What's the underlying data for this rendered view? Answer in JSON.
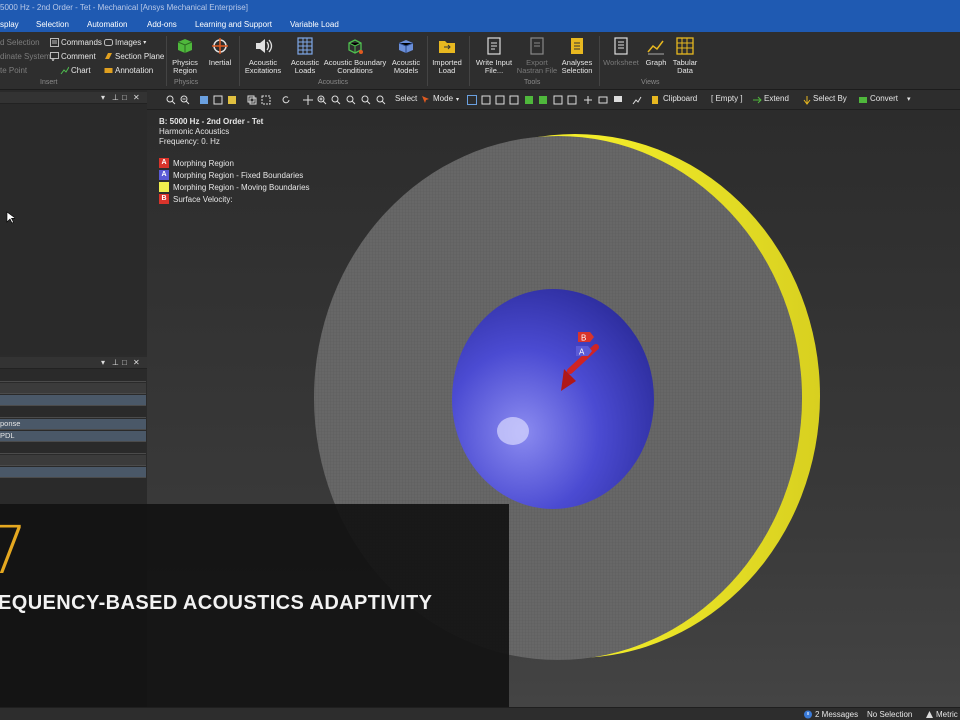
{
  "window": {
    "title": "5000 Hz - 2nd Order - Tet - Mechanical [Ansys Mechanical Enterprise]"
  },
  "menu": {
    "items": [
      "splay",
      "Selection",
      "Automation",
      "Add-ons",
      "Learning and Support",
      "Variable Load"
    ]
  },
  "ribbon": {
    "insert_small": {
      "named_selection": "d Selection",
      "coordinate_system": "dinate System",
      "remote_point": "te Point",
      "commands": "Commands",
      "comment": "Comment",
      "chart": "Chart",
      "images": "Images",
      "section_plane": "Section Plane",
      "annotation": "Annotation"
    },
    "groups": {
      "insert": "Insert",
      "physics": "Physics",
      "acoustics": "Acoustics",
      "tools": "Tools",
      "views": "Views"
    },
    "buttons": {
      "physics_region": "Physics\nRegion",
      "inertial": "Inertial",
      "acoustic_excitations": "Acoustic\nExcitations",
      "acoustic_loads": "Acoustic\nLoads",
      "acoustic_boundary_conditions": "Acoustic Boundary\nConditions",
      "acoustic_models": "Acoustic\nModels",
      "imported_load": "Imported\nLoad",
      "write_input_file": "Write Input\nFile...",
      "export_nastran_file": "Export\nNastran File",
      "analyses_selection": "Analyses\nSelection",
      "worksheet": "Worksheet",
      "graph": "Graph",
      "tabular_data": "Tabular\nData"
    }
  },
  "graphics_toolbar": {
    "select": "Select",
    "mode": "Mode",
    "clipboard": "Clipboard",
    "empty": "[ Empty ]",
    "extend": "Extend",
    "select_by": "Select By",
    "convert": "Convert"
  },
  "left_panel": {
    "rows": [
      "ponse",
      "PDL"
    ]
  },
  "viewport": {
    "analysis_title": "B: 5000 Hz - 2nd Order - Tet",
    "analysis_type": "Harmonic Acoustics",
    "frequency": "Frequency: 0. Hz",
    "legend": [
      {
        "tag": "A",
        "label": "Morphing Region",
        "color": "#d9342b"
      },
      {
        "tag": "A",
        "label": "Morphing Region - Fixed Boundaries",
        "color": "#5a5ad6"
      },
      {
        "tag": "",
        "label": "Morphing Region - Moving Boundaries",
        "color": "#f0ef4e"
      },
      {
        "tag": "B",
        "label": "Surface Velocity:",
        "color": "#d9342b"
      }
    ],
    "marker_b": "B",
    "marker_a": "A"
  },
  "banner": {
    "number": "7",
    "title": "EQUENCY-BASED ACOUSTICS ADAPTIVITY"
  },
  "status": {
    "messages": "2 Messages",
    "selection": "No Selection",
    "units": "Metric"
  },
  "colors": {
    "title_bar": "#1f5ab2",
    "inner_sphere": "#4a4ad0",
    "outer_ring": "#f0ec1c",
    "banner_number": "#e5a820"
  }
}
